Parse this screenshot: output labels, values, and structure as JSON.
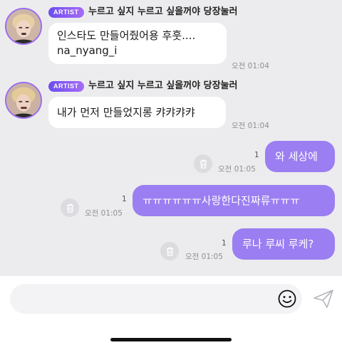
{
  "messages_in": [
    {
      "badge": "ARTIST",
      "sender": "누르고 싶지 누르고 싶을꺼야 당장눌러",
      "lines": [
        "인스타도 만들어줬어용 후훗....",
        "na_nyang_i"
      ],
      "time": "오전 01:04"
    },
    {
      "badge": "ARTIST",
      "sender": "누르고 싶지 누르고 싶을꺼야 당장눌러",
      "lines": [
        "내가 먼저 만들었지롱 캬캬캬캬"
      ],
      "time": "오전 01:04"
    }
  ],
  "messages_out": [
    {
      "text": "와 세상에",
      "count": "1",
      "time": "오전 01:05"
    },
    {
      "text": "ㅠㅠㅠㅠㅠㅠ사랑한다진짜류ㅠㅠㅠ",
      "count": "1",
      "time": "오전 01:05"
    },
    {
      "text": "루나 루씨 루케?",
      "count": "1",
      "time": "오전 01:05"
    }
  ],
  "composer": {
    "placeholder": ""
  },
  "icons": {
    "delete": "trash-icon",
    "emoji": "smiley-icon",
    "send": "paper-plane-icon"
  },
  "colors": {
    "bubble_out": "#9b7ef2",
    "badge": "#7b55f2",
    "avatar_ring": "#9a6cf0"
  }
}
